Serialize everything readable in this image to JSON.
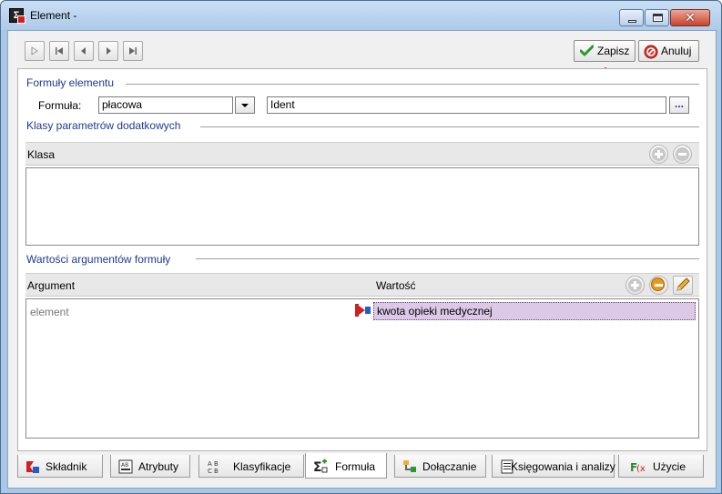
{
  "window": {
    "title": "Element -"
  },
  "toolbar": {
    "save_label": "Zapisz",
    "cancel_label": "Anuluj"
  },
  "sections": {
    "formulas": {
      "title": "Formuły elementu",
      "formula_label": "Formuła:",
      "formula_value": "płacowa",
      "ident_value": "Ident",
      "ellipsis_label": "..."
    },
    "param_classes": {
      "title": "Klasy parametrów dodatkowych",
      "column_header": "Klasa"
    },
    "arg_values": {
      "title": "Wartości argumentów formuły",
      "columns": [
        "Argument",
        "Wartość"
      ],
      "rows": [
        {
          "argument": "element",
          "value": "kwota opieki medycznej"
        }
      ]
    }
  },
  "tabs": [
    {
      "label": "Składnik",
      "icon": "component-icon"
    },
    {
      "label": "Atrybuty",
      "icon": "attributes-icon"
    },
    {
      "label": "Klasyfikacje",
      "icon": "classification-icon"
    },
    {
      "label": "Formuła",
      "icon": "sigma-icon",
      "active": true
    },
    {
      "label": "Dołączanie",
      "icon": "attach-icon"
    },
    {
      "label": "Księgowania i analizy",
      "icon": "ledger-icon"
    },
    {
      "label": "Użycie",
      "icon": "function-icon"
    }
  ],
  "colors": {
    "section_title": "#1f3a93",
    "row_highlight": "#dcc9e8",
    "annotation_arrow": "#e0302a"
  }
}
